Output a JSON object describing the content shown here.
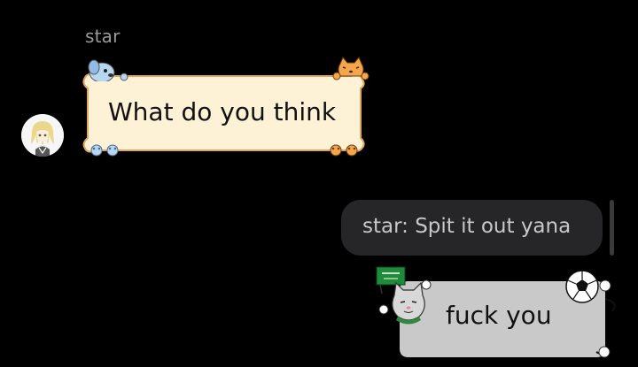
{
  "incoming": {
    "sender": "star",
    "message": "What do you think"
  },
  "outgoing": {
    "quote": "star: Spit it out yana",
    "message": "fuck you",
    "flag_text": "لا إله إلا الله"
  },
  "colors": {
    "background": "#000000",
    "incoming_bubble": "#fdf1d6",
    "incoming_border": "#e0a75a",
    "outgoing_bubble": "#c9c9c9",
    "quote_bubble": "#262628",
    "sender_name": "#9a9a9a"
  },
  "icons": {
    "dog": "blue-dog-icon",
    "cat": "orange-cat-icon",
    "paws_left": "blue-paw-prints-icon",
    "paws_right": "orange-paw-prints-icon",
    "grey_cat": "grey-cat-icon",
    "soccer": "soccer-ball-icon",
    "flag": "saudi-flag-icon"
  }
}
